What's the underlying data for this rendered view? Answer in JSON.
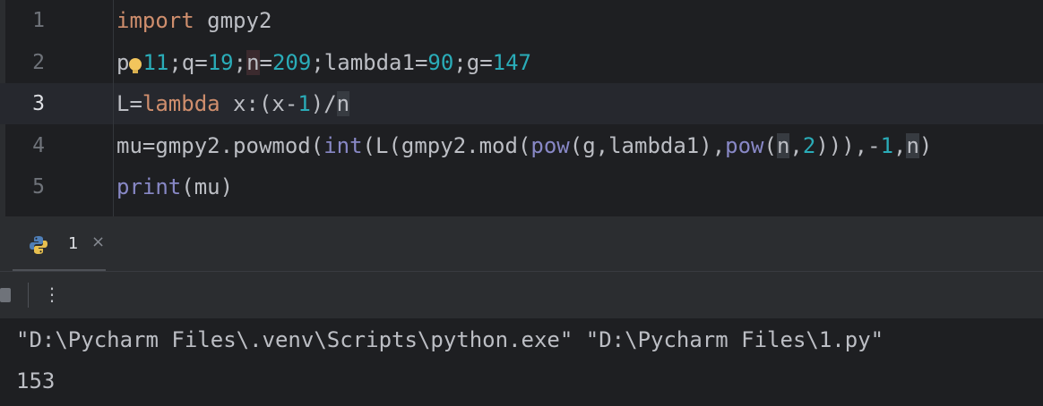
{
  "editor": {
    "line_numbers": [
      "1",
      "2",
      "3",
      "4",
      "5"
    ],
    "lines": {
      "l1": {
        "kw": "import",
        "rest": " gmpy2"
      },
      "l2": {
        "a": "p",
        "b": "11",
        "c": ";q=",
        "d": "19",
        "e": ";",
        "f": "n",
        "g": "=",
        "h": "209",
        "i": ";lambda1=",
        "j": "90",
        "k": ";g=",
        "l": "147"
      },
      "l3": {
        "a": "L=",
        "b": "lambda",
        "c": " x:(x-",
        "d": "1",
        "e": ")/",
        "f": "n"
      },
      "l4": {
        "a": "mu=gmpy2.powmod(",
        "b": "int",
        "c": "(L(gmpy2.mod(",
        "d": "pow",
        "e": "(g,lambda1),",
        "f": "pow",
        "g": "(",
        "h": "n",
        "i": ",",
        "j": "2",
        "k": "))),-",
        "l": "1",
        "m": ",",
        "n": "n",
        "o": ")"
      },
      "l5": {
        "a": "print",
        "b": "(mu)"
      }
    }
  },
  "run_panel": {
    "tab_label": "1",
    "close_glyph": "×",
    "more_glyph": "⋮"
  },
  "console": {
    "command": "\"D:\\Pycharm Files\\.venv\\Scripts\\python.exe\" \"D:\\Pycharm Files\\1.py\"",
    "output": "153"
  },
  "colors": {
    "keyword": "#cf8e6d",
    "number": "#2aacb8",
    "builtin": "#8888c6",
    "text": "#bcbec4",
    "background": "#1e1f22"
  }
}
